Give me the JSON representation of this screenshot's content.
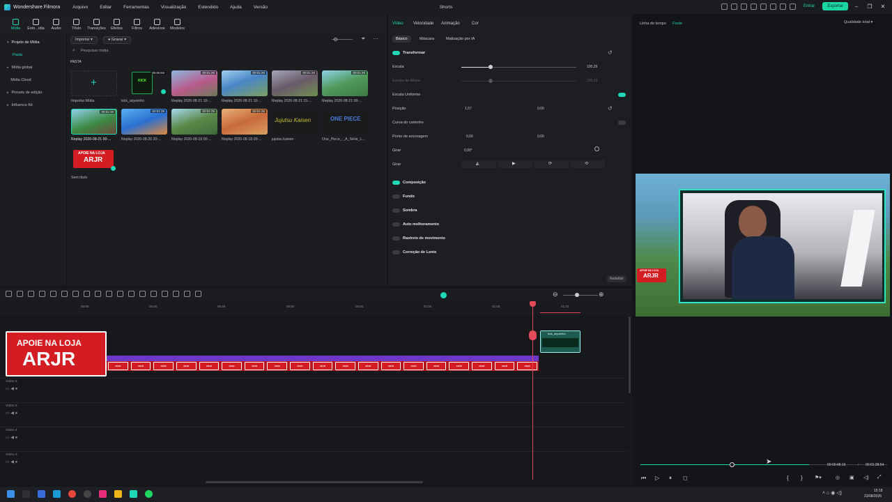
{
  "app": {
    "name": "Wondershare Filmora",
    "project": "Shorts"
  },
  "menu": [
    "Arquivo",
    "Editar",
    "Ferramentas",
    "Visualização",
    "Estendido",
    "Ajuda",
    "Versão"
  ],
  "titlebar": {
    "login": "Entrar",
    "export": "Exportar"
  },
  "media_toolbar": [
    "Mídia",
    "Esto...ídia",
    "Áudio",
    "Título",
    "Transições",
    "Efeitos",
    "Filtros",
    "Adesivos",
    "Modelos"
  ],
  "left_nav": [
    {
      "label": "Projeto de Mídia",
      "expanded": true
    },
    {
      "label": "Pasta",
      "sub": true
    },
    {
      "label": "Mídia global"
    },
    {
      "label": "Mídia Cloud"
    },
    {
      "label": "Presets de edição"
    },
    {
      "label": "Influence Kit"
    }
  ],
  "media_bin": {
    "import_btn": "Importar",
    "record_btn": "Gravar",
    "search_placeholder": "Pesquisar mídia",
    "folder": "PASTA",
    "items": [
      {
        "label": "Importar Mídia",
        "dur": ""
      },
      {
        "label": "kick_arjuninho",
        "dur": "00:00:03"
      },
      {
        "label": "Replay 2026-08-21 10-...",
        "dur": "00:01:29"
      },
      {
        "label": "Replay 2026-08-21 10-...",
        "dur": "00:01:29"
      },
      {
        "label": "Replay 2026-08-21 01-...",
        "dur": "00:01:28"
      },
      {
        "label": "Replay 2026-08-21 00-...",
        "dur": "00:01:29"
      },
      {
        "label": "Replay 2026-08-21 00-...",
        "dur": "00:01:28"
      },
      {
        "label": "Replay 2026-08-20 20-...",
        "dur": "00:01:29"
      },
      {
        "label": "Replay 2026-08-19 00-...",
        "dur": "00:01:29"
      },
      {
        "label": "Replay 2026-08-18 09-...",
        "dur": "00:01:26"
      },
      {
        "label": "jujutsu kaisen",
        "dur": ""
      },
      {
        "label": "One_Piece_-_A_Série_L...",
        "dur": ""
      },
      {
        "label": "Sem título",
        "dur": ""
      }
    ]
  },
  "inspector": {
    "tabs": [
      "Vídeo",
      "Velocidade",
      "Animação",
      "Cor"
    ],
    "subtabs": [
      "Básico",
      "Máscara",
      "Matização por IA"
    ],
    "transform": "Transformar",
    "scale": "Escala",
    "scale_val": "100,29",
    "scale_h": "Escala de Altura",
    "scale_h_val": "100,29",
    "uniform": "Escala Uniforme",
    "position": "Posição",
    "pos_x": "1,57",
    "pos_y": "0,00",
    "path": "Curva do caminho",
    "anchor": "Ponto de ancoragem",
    "anc_x": "0,00",
    "anc_y": "0,00",
    "rotate": "Girar",
    "rotate_val": "0,00°",
    "flip": "Girar",
    "composition": "Composição",
    "bg": "Fundo",
    "shadow": "Sombra",
    "auto": "Auto melhoramento",
    "track": "Rastreio de movimento",
    "lens": "Correção de Lente",
    "reset": "Redefinir"
  },
  "preview": {
    "timeline_tab": "Linha do tempo",
    "source_tab": "Fonte",
    "quality": "Qualidade total",
    "time_current": "00:00:48:16",
    "time_total": "00:01:28:54",
    "overlay_line1": "APOIE NA LOJA",
    "overlay_line2": "ARJR"
  },
  "timeline": {
    "ruler": [
      "00:05",
      "00:40",
      "00:45",
      "00:50",
      "00:55",
      "01:00",
      "01:05",
      "01:10"
    ],
    "tracks": [
      "Vídeo 6",
      "Vídeo 5",
      "Vídeo 4",
      "Vídeo 3"
    ],
    "clip_label": "kick_arjuninho",
    "banner_line1": "APOIE NA LOJA",
    "banner_line2": "ARJR"
  },
  "taskbar": {
    "time": "15:18",
    "date": "23/08/2026"
  }
}
